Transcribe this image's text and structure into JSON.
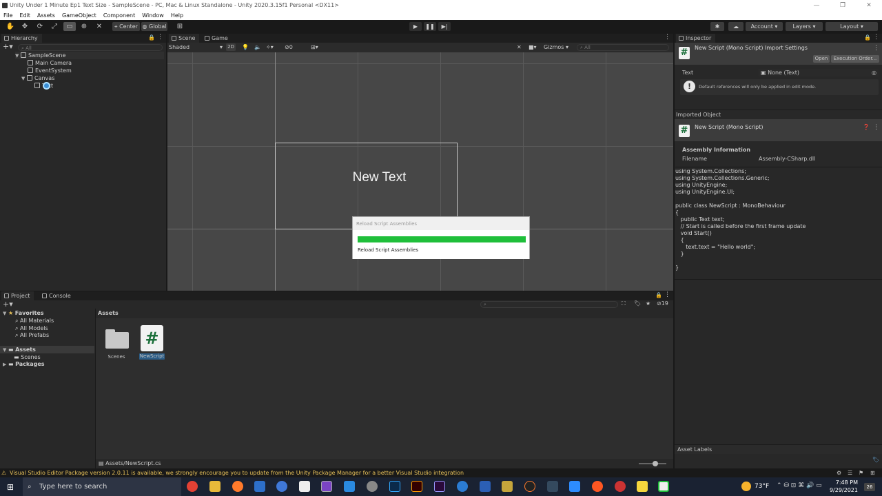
{
  "window": {
    "title": "Unity Under 1 Minute Ep1 Text Size - SampleScene - PC, Mac & Linux Standalone - Unity 2020.3.15f1 Personal <DX11>",
    "menu": [
      "File",
      "Edit",
      "Assets",
      "GameObject",
      "Component",
      "Window",
      "Help"
    ]
  },
  "toolbar": {
    "center_label": "Center",
    "global_label": "Global",
    "account_label": "Account",
    "layers_label": "Layers",
    "layout_label": "Layout"
  },
  "hierarchy": {
    "tab": "Hierarchy",
    "search_placeholder": "All",
    "scene": "SampleScene",
    "items": [
      "Main Camera",
      "EventSystem",
      "Canvas",
      "Text"
    ]
  },
  "scene": {
    "tabs": [
      "Scene",
      "Game"
    ],
    "shading": "Shaded",
    "mode_2d": "2D",
    "hidden_count": "0",
    "gizmos": "Gizmos",
    "search_placeholder": "All",
    "canvas_text": "New Text"
  },
  "dialog": {
    "title": "Reload Script Assemblies",
    "status": "Reload Script Assemblies",
    "progress": 1.0,
    "color": "#1fbf3a"
  },
  "inspector": {
    "tab": "Inspector",
    "header": "New Script (Mono Script) Import Settings",
    "open_btn": "Open",
    "exec_btn": "Execution Order...",
    "field_label": "Text",
    "field_value": "None (Text)",
    "info": "Default references will only be applied in edit mode.",
    "imported_label": "Imported Object",
    "imported_name": "New Script (Mono Script)",
    "assembly_info": "Assembly Information",
    "filename_label": "Filename",
    "filename_value": "Assembly-CSharp.dll",
    "code": "using System.Collections;\nusing System.Collections.Generic;\nusing UnityEngine;\nusing UnityEngine.UI;\n\npublic class NewScript : MonoBehaviour\n{\n   public Text text;\n   // Start is called before the first frame update\n   void Start()\n   {\n      text.text = \"Hello world\";\n   }\n\n}",
    "asset_labels": "Asset Labels"
  },
  "project": {
    "tabs": [
      "Project",
      "Console"
    ],
    "favorites": "Favorites",
    "fav_items": [
      "All Materials",
      "All Models",
      "All Prefabs"
    ],
    "assets_root": "Assets",
    "scenes": "Scenes",
    "packages": "Packages",
    "breadcrumb": "Assets",
    "grid_items": [
      "Scenes",
      "NewScript"
    ],
    "hidden_count": "19",
    "path": "Assets/NewScript.cs"
  },
  "status_warning": "Visual Studio Editor Package version 2.0.11 is available, we strongly encourage you to update from the Unity Package Manager for a better Visual Studio integration",
  "taskbar": {
    "search_placeholder": "Type here to search",
    "weather": "73°F",
    "time": "7:48 PM",
    "date": "9/29/2021",
    "notif_count": "26"
  }
}
